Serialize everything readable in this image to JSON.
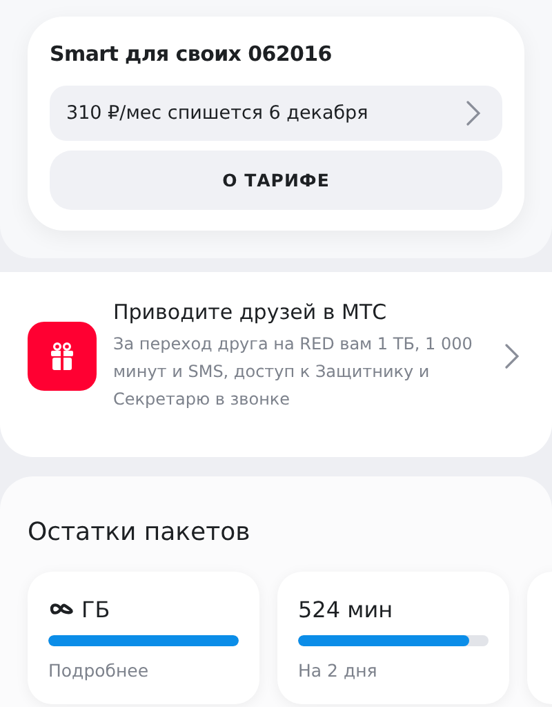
{
  "tariff": {
    "title": "Smart для своих 062016",
    "payment": "310 ₽/мес спишется 6 декабря",
    "button": "О ТАРИФЕ"
  },
  "promo": {
    "title": "Приводите друзей в МТС",
    "text": "За переход друга на RED вам 1 ТБ, 1 000 минут и SMS, доступ к Защитнику и Секретарю в звонке"
  },
  "packages": {
    "title": "Остатки пакетов",
    "items": [
      {
        "kind": "infinite",
        "value": "ГБ",
        "level": 1,
        "note": "Подробнее"
      },
      {
        "kind": "amount",
        "value": "524 мин",
        "level": 0.9,
        "note": "На 2 дня"
      }
    ]
  }
}
